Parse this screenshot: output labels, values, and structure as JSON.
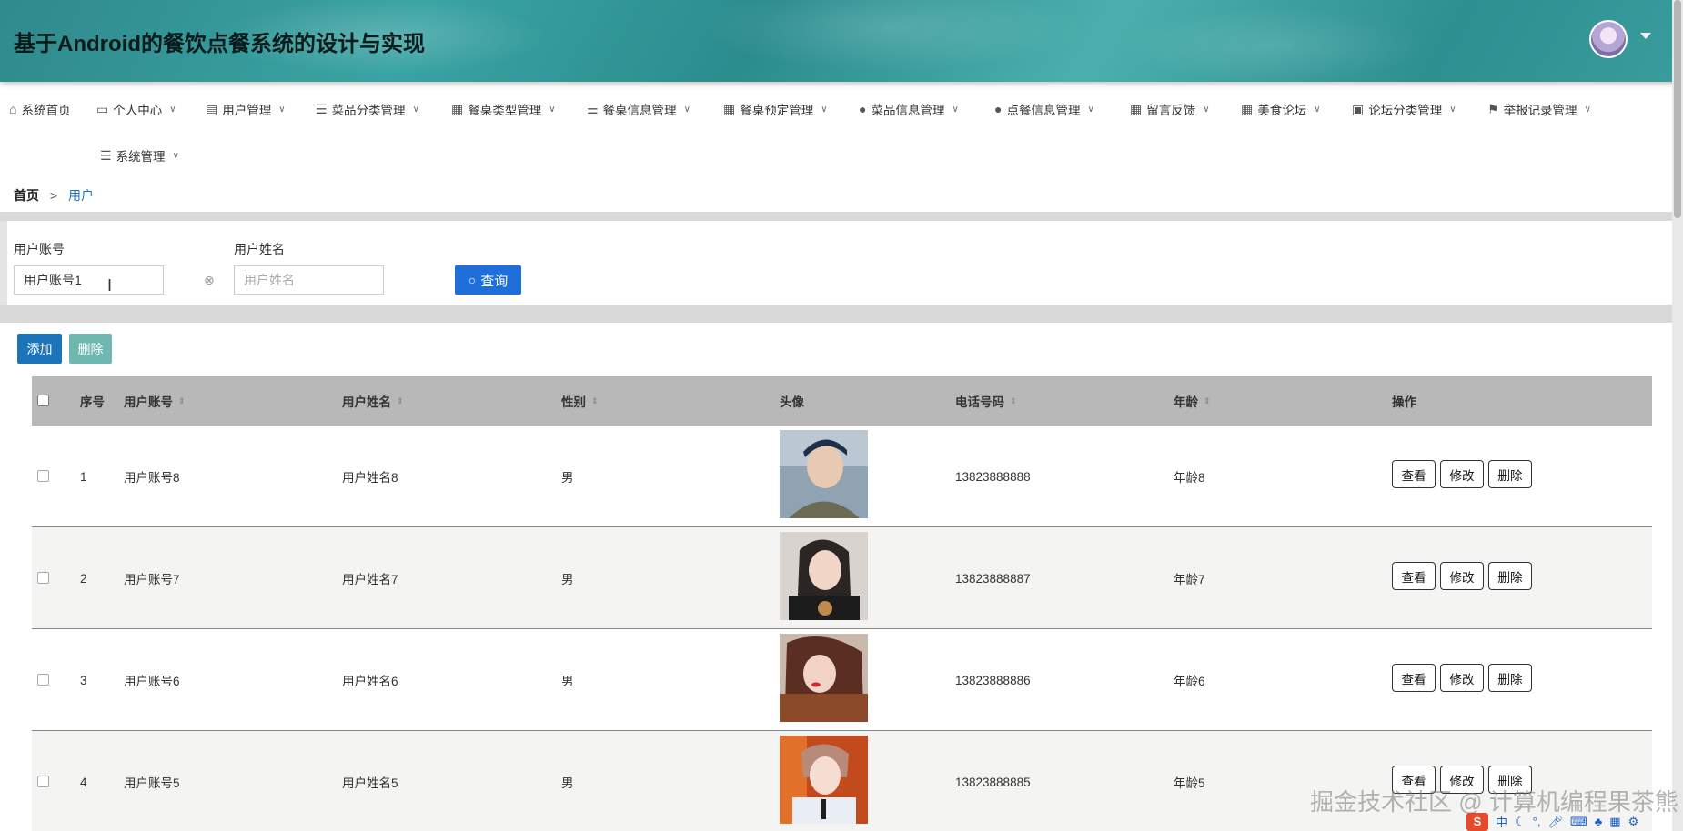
{
  "app": {
    "title": "基于Android的餐饮点餐系统的设计与实现"
  },
  "nav": {
    "items": [
      {
        "label": "系统首页",
        "icon": "home-icon",
        "dropdown": false
      },
      {
        "label": "个人中心",
        "icon": "card-icon",
        "dropdown": true
      },
      {
        "label": "用户管理",
        "icon": "clipboard-icon",
        "dropdown": true
      },
      {
        "label": "菜品分类管理",
        "icon": "list-icon",
        "dropdown": true
      },
      {
        "label": "餐桌类型管理",
        "icon": "grid-icon",
        "dropdown": true
      },
      {
        "label": "餐桌信息管理",
        "icon": "sliders-icon",
        "dropdown": true
      },
      {
        "label": "餐桌预定管理",
        "icon": "grid-icon",
        "dropdown": true
      },
      {
        "label": "菜品信息管理",
        "icon": "user-icon",
        "dropdown": true
      },
      {
        "label": "点餐信息管理",
        "icon": "user-icon",
        "dropdown": true
      },
      {
        "label": "留言反馈",
        "icon": "grid-icon",
        "dropdown": true
      },
      {
        "label": "美食论坛",
        "icon": "grid-icon",
        "dropdown": true
      },
      {
        "label": "论坛分类管理",
        "icon": "doc-icon",
        "dropdown": true
      },
      {
        "label": "举报记录管理",
        "icon": "flag-icon",
        "dropdown": true
      },
      {
        "label": "系统管理",
        "icon": "list-icon",
        "dropdown": true
      }
    ]
  },
  "breadcrumb": {
    "home": "首页",
    "separator": ">",
    "current": "用户"
  },
  "search": {
    "account_label": "用户账号",
    "account_value": "用户账号1",
    "name_label": "用户姓名",
    "name_placeholder": "用户姓名",
    "search_button": "查询"
  },
  "toolbar": {
    "add_label": "添加",
    "delete_label": "删除"
  },
  "table": {
    "columns": [
      "序号",
      "用户账号",
      "用户姓名",
      "性别",
      "头像",
      "电话号码",
      "年龄",
      "操作"
    ],
    "rows": [
      {
        "index": "1",
        "account": "用户账号8",
        "name": "用户姓名8",
        "gender": "男",
        "phone": "13823888888",
        "age": "年龄8"
      },
      {
        "index": "2",
        "account": "用户账号7",
        "name": "用户姓名7",
        "gender": "男",
        "phone": "13823888887",
        "age": "年龄7"
      },
      {
        "index": "3",
        "account": "用户账号6",
        "name": "用户姓名6",
        "gender": "男",
        "phone": "13823888886",
        "age": "年龄6"
      },
      {
        "index": "4",
        "account": "用户账号5",
        "name": "用户姓名5",
        "gender": "男",
        "phone": "13823888885",
        "age": "年龄5"
      }
    ],
    "actions": {
      "view": "查看",
      "edit": "修改",
      "delete": "删除"
    }
  },
  "watermark": "掘金技术社区 @ 计算机编程果茶熊",
  "taskbar": {
    "ime": "S",
    "lang": "中"
  },
  "colors": {
    "primary": "#1e74b8",
    "search_button": "#1e6fd9",
    "delete_button": "#6fb8b2",
    "table_header": "#b8b8b8",
    "header_teal": "#2f8a8c"
  }
}
